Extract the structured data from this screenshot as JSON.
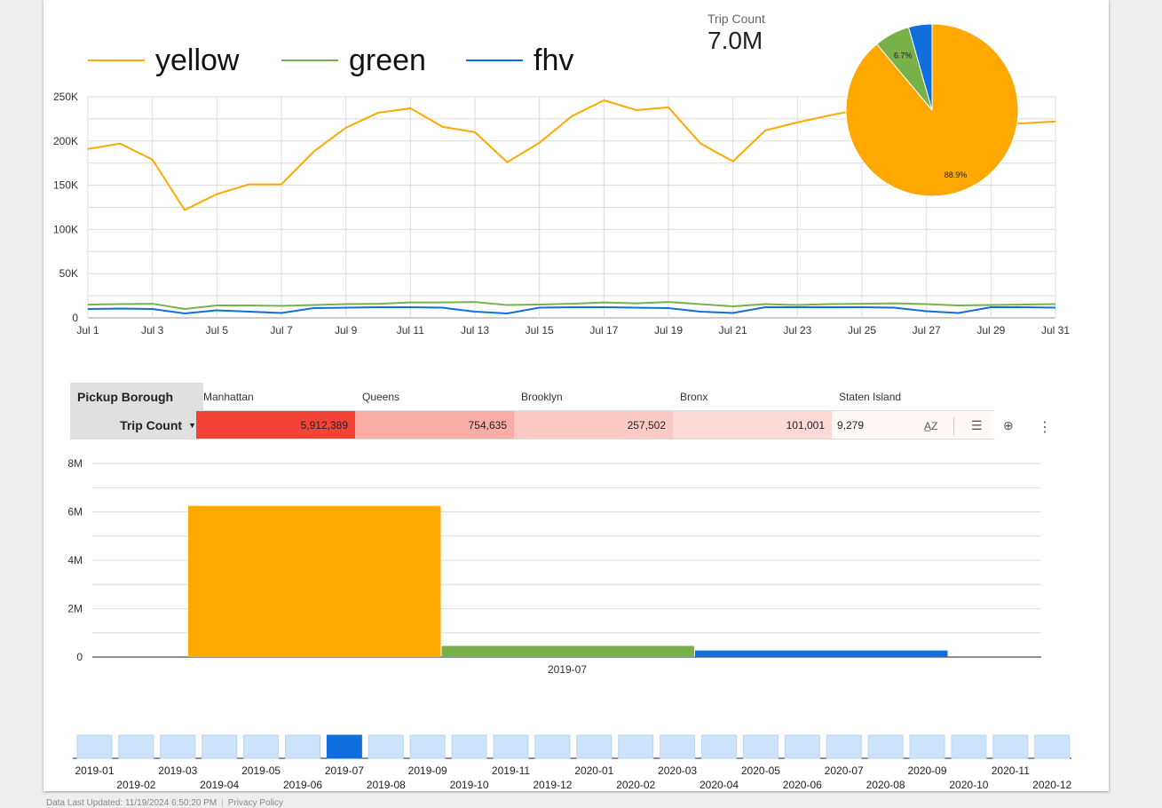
{
  "colors": {
    "yellow": "#ffa800",
    "green": "#78b04a",
    "fhv": "#0f6fde",
    "pivot_dark": "#f44336"
  },
  "legend": [
    {
      "name": "yellow",
      "color": "#ffa800"
    },
    {
      "name": "green",
      "color": "#78b04a"
    },
    {
      "name": "fhv",
      "color": "#0f6fde"
    }
  ],
  "scorecard": {
    "label": "Trip Count",
    "value": "7.0M"
  },
  "pivot": {
    "row_header": "Pickup Borough",
    "metric_header": "Trip Count",
    "sort_icon": "caret-down-icon",
    "columns": [
      "Manhattan",
      "Queens",
      "Brooklyn",
      "Bronx",
      "Staten Island"
    ],
    "values": [
      "5,912,389",
      "754,635",
      "257,502",
      "101,001",
      "9,279"
    ],
    "raw": [
      5912389,
      754635,
      257502,
      101001,
      9279
    ],
    "toolbar": [
      "sort-az-icon",
      "filter-icon",
      "zoom-icon",
      "more-vert-icon"
    ]
  },
  "footer": {
    "updated": "Data Last Updated: 11/19/2024 6:50:20 PM",
    "privacy": "Privacy Policy"
  },
  "chart_data": [
    {
      "type": "line",
      "x": [
        "Jul 1",
        "Jul 2",
        "Jul 3",
        "Jul 4",
        "Jul 5",
        "Jul 6",
        "Jul 7",
        "Jul 8",
        "Jul 9",
        "Jul 10",
        "Jul 11",
        "Jul 12",
        "Jul 13",
        "Jul 14",
        "Jul 15",
        "Jul 16",
        "Jul 17",
        "Jul 18",
        "Jul 19",
        "Jul 20",
        "Jul 21",
        "Jul 22",
        "Jul 23",
        "Jul 24",
        "Jul 25",
        "Jul 26",
        "Jul 27",
        "Jul 28",
        "Jul 29",
        "Jul 30",
        "Jul 31"
      ],
      "xticks": [
        "Jul 1",
        "Jul 3",
        "Jul 5",
        "Jul 7",
        "Jul 9",
        "Jul 11",
        "Jul 13",
        "Jul 15",
        "Jul 17",
        "Jul 19",
        "Jul 21",
        "Jul 23",
        "Jul 25",
        "Jul 27",
        "Jul 29",
        "Jul 31"
      ],
      "yticks": [
        "0",
        "50K",
        "100K",
        "150K",
        "200K",
        "250K"
      ],
      "ylim": [
        0,
        250000
      ],
      "grid": true,
      "legend_position": "top",
      "series": [
        {
          "name": "yellow",
          "values": [
            191000,
            197000,
            179000,
            122000,
            140000,
            151000,
            151000,
            188000,
            215000,
            232000,
            237000,
            216000,
            210000,
            176000,
            198000,
            228000,
            246000,
            235000,
            238000,
            197000,
            177000,
            212000,
            221000,
            229000,
            236000,
            238000,
            231000,
            225000,
            219000,
            220000,
            222000
          ]
        },
        {
          "name": "green",
          "values": [
            15000,
            15500,
            16000,
            10000,
            14000,
            14000,
            13500,
            14500,
            15500,
            16000,
            17500,
            17500,
            18000,
            14500,
            15000,
            16000,
            17500,
            16500,
            18000,
            15500,
            13000,
            15500,
            14500,
            15500,
            16000,
            16500,
            15500,
            14000,
            14500,
            15000,
            15500
          ]
        },
        {
          "name": "fhv",
          "values": [
            10000,
            10500,
            10000,
            5000,
            8500,
            7000,
            5500,
            11000,
            11500,
            12000,
            12000,
            11500,
            7000,
            5000,
            11500,
            12000,
            12000,
            11500,
            11000,
            7000,
            5500,
            12000,
            12000,
            12000,
            12000,
            11500,
            7500,
            5500,
            12000,
            12000,
            11500
          ]
        }
      ]
    },
    {
      "type": "pie",
      "slices": [
        {
          "name": "yellow",
          "value": 88.9,
          "label": "88.9%"
        },
        {
          "name": "green",
          "value": 6.7,
          "label": "6.7%"
        },
        {
          "name": "fhv",
          "value": 4.4,
          "label": ""
        }
      ]
    },
    {
      "type": "bar",
      "categories": [
        "2019-07"
      ],
      "series": [
        {
          "name": "yellow",
          "values": [
            6250000
          ]
        },
        {
          "name": "green",
          "values": [
            460000
          ]
        },
        {
          "name": "fhv",
          "values": [
            270000
          ]
        }
      ],
      "yticks": [
        "0",
        "2M",
        "4M",
        "6M",
        "8M"
      ],
      "ylim": [
        0,
        8000000
      ],
      "grid": true
    },
    {
      "type": "bar",
      "categories": [
        "2019-01",
        "2019-02",
        "2019-03",
        "2019-04",
        "2019-05",
        "2019-06",
        "2019-07",
        "2019-08",
        "2019-09",
        "2019-10",
        "2019-11",
        "2019-12",
        "2020-01",
        "2020-02",
        "2020-03",
        "2020-04",
        "2020-05",
        "2020-06",
        "2020-07",
        "2020-08",
        "2020-09",
        "2020-10",
        "2020-11",
        "2020-12"
      ],
      "selected": "2019-07"
    }
  ]
}
